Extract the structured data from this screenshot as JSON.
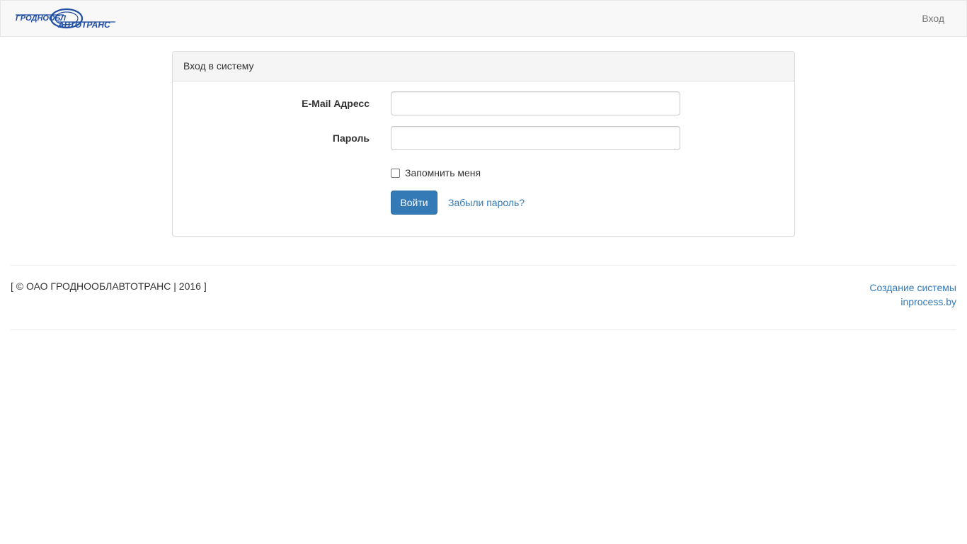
{
  "navbar": {
    "brand_logo": {
      "text_top": "ГРОДНООБЛ",
      "text_bottom": "АВТОТРАНС",
      "color": "#1f4fa3"
    },
    "login_link": "Вход"
  },
  "login_panel": {
    "heading": "Вход в систему",
    "email_label": "E-Mail Адресс",
    "email_value": "",
    "password_label": "Пароль",
    "password_value": "",
    "remember_label": "Запомнить меня",
    "remember_checked": false,
    "submit_label": "Войти",
    "forgot_link": "Забыли пароль?"
  },
  "footer": {
    "copyright": "[ © ОАО ГРОДНООБЛАВТОТРАНС | 2016 ]",
    "credits_line1": "Создание системы",
    "credits_line2": "inprocess.by"
  },
  "colors": {
    "primary": "#337ab7",
    "navbar_bg": "#f8f8f8",
    "panel_heading_bg": "#f5f5f5"
  }
}
